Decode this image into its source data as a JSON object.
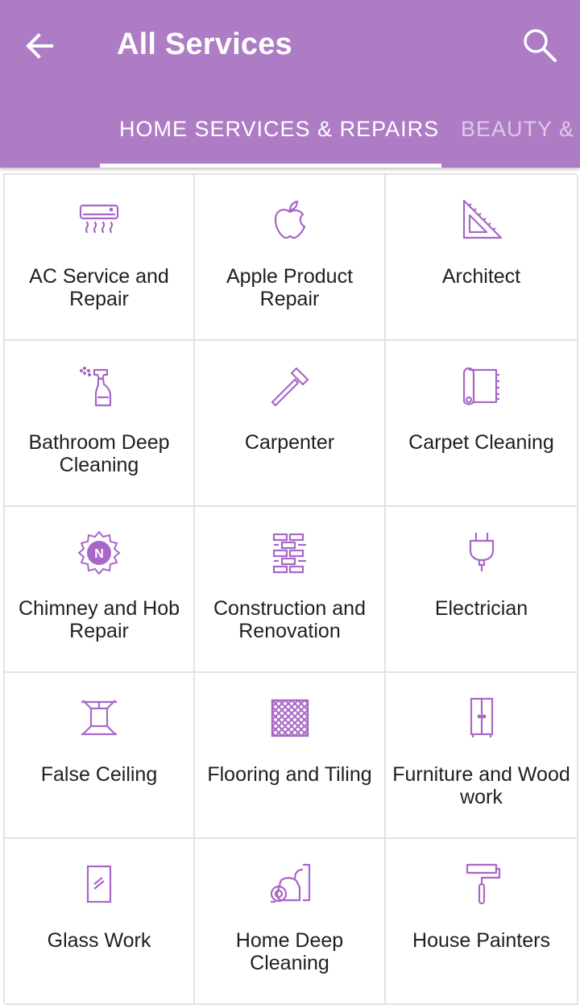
{
  "header": {
    "title": "All Services",
    "back_icon": "arrow-left-icon",
    "search_icon": "search-icon",
    "background_color": "#ad7cc4"
  },
  "tabs": [
    {
      "label": "HOME SERVICES & REPAIRS",
      "selected": true
    },
    {
      "label": "BEAUTY & F",
      "selected": false
    }
  ],
  "accent_color": "#a867c7",
  "services": [
    {
      "label": "AC Service and Repair",
      "icon": "air-conditioner-icon"
    },
    {
      "label": "Apple Product Repair",
      "icon": "apple-icon"
    },
    {
      "label": "Architect",
      "icon": "set-square-icon"
    },
    {
      "label": "Bathroom Deep Cleaning",
      "icon": "spray-bottle-icon"
    },
    {
      "label": "Carpenter",
      "icon": "hammer-icon"
    },
    {
      "label": "Carpet Cleaning",
      "icon": "carpet-roll-icon"
    },
    {
      "label": "Chimney and Hob Repair",
      "icon": "chimney-badge-icon"
    },
    {
      "label": "Construction and Renovation",
      "icon": "brick-wall-icon"
    },
    {
      "label": "Electrician",
      "icon": "plug-icon"
    },
    {
      "label": "False Ceiling",
      "icon": "ceiling-lamp-icon"
    },
    {
      "label": "Flooring and Tiling",
      "icon": "tiles-icon"
    },
    {
      "label": "Furniture and Wood work",
      "icon": "wardrobe-icon"
    },
    {
      "label": "Glass Work",
      "icon": "glass-pane-icon"
    },
    {
      "label": "Home Deep Cleaning",
      "icon": "vacuum-cleaner-icon"
    },
    {
      "label": "House Painters",
      "icon": "paint-roller-icon"
    }
  ]
}
